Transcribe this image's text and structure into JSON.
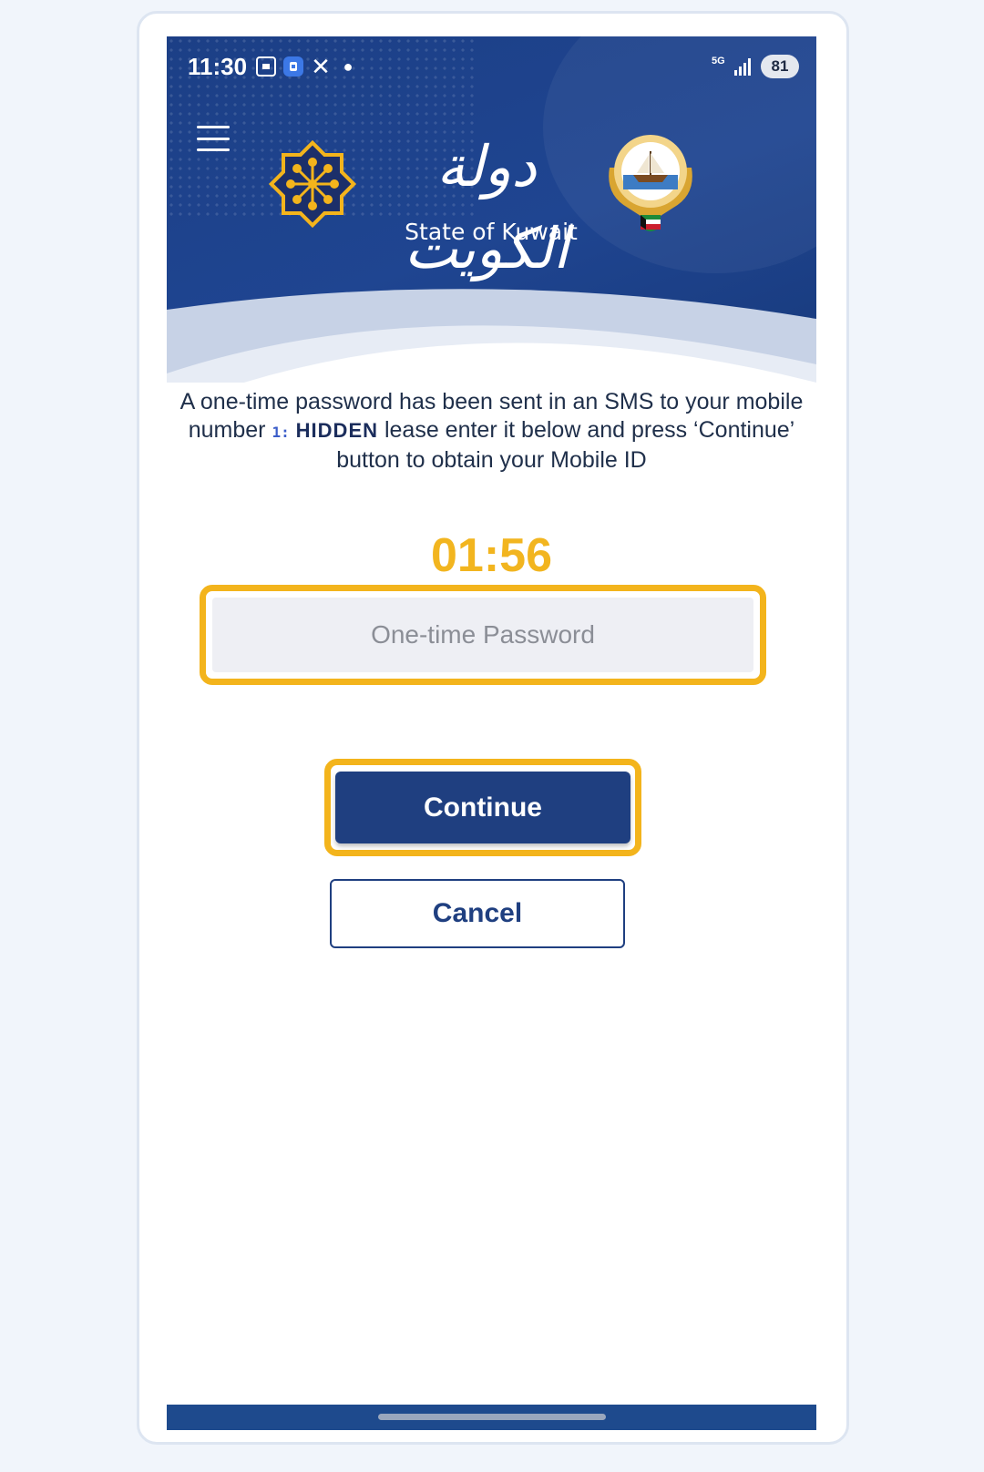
{
  "status_bar": {
    "time": "11:30",
    "network": "5G",
    "battery": "81"
  },
  "header": {
    "arabic_title": "دولة الكويت",
    "title": "State of Kuwait"
  },
  "message": {
    "part1": "A one-time password has been sent in an SMS to your mobile number",
    "number_prefix": "1:",
    "hidden_label": "HIDDEN",
    "part2": "lease enter it below and press ‘Continue’ button to obtain your Mobile ID"
  },
  "timer": "01:56",
  "otp": {
    "placeholder": "One-time Password",
    "value": ""
  },
  "buttons": {
    "continue": "Continue",
    "cancel": "Cancel"
  },
  "colors": {
    "brand_blue": "#1f3f80",
    "highlight": "#f3b41c",
    "timer": "#f2b51f"
  }
}
